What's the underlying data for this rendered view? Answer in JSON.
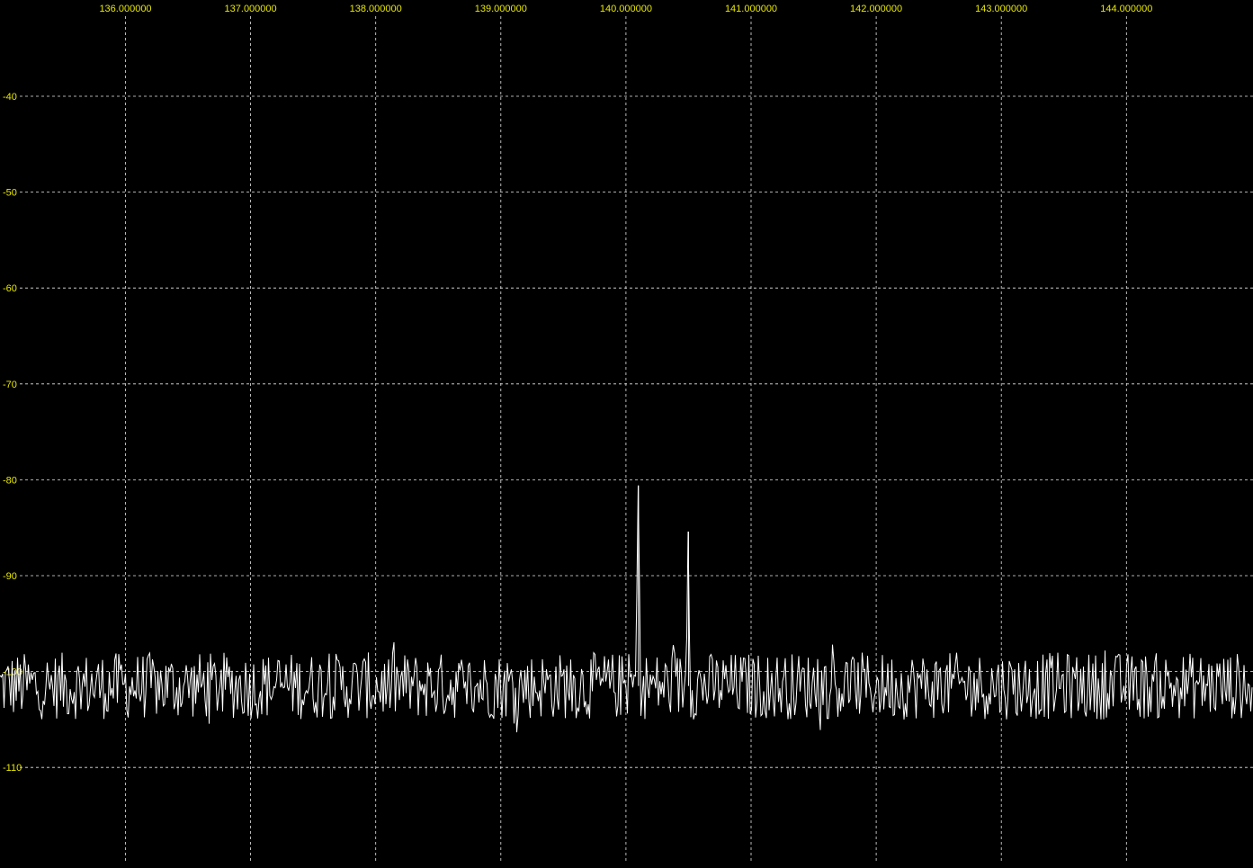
{
  "colors": {
    "background": "#000000",
    "grid": "#e6e6e6",
    "tick_label": "#e8e800",
    "trace": "#ffffff"
  },
  "chart_data": {
    "type": "line",
    "title": "",
    "xlabel": "",
    "ylabel": "",
    "grid": true,
    "grid_style": "dashed",
    "x_ticks": [
      136,
      137,
      138,
      139,
      140,
      141,
      142,
      143,
      144
    ],
    "x_tick_labels": [
      "136.000000",
      "137.000000",
      "138.000000",
      "139.000000",
      "140.000000",
      "141.000000",
      "142.000000",
      "143.000000",
      "144.000000"
    ],
    "y_ticks": [
      -40,
      -50,
      -60,
      -70,
      -80,
      -90,
      -100,
      -110
    ],
    "y_tick_labels": [
      "-40",
      "-50",
      "-60",
      "-70",
      "-80",
      "-90",
      "-100",
      "-110"
    ],
    "xlim": [
      135.0,
      145.0
    ],
    "ylim": [
      -30.0,
      -120.0
    ],
    "series": [
      {
        "noise_floor_db": -101.5,
        "noise_min_db": -106,
        "noise_max_db": -98,
        "peaks": [
          {
            "x": 140.1,
            "y": -80.6
          },
          {
            "x": 140.5,
            "y": -85.4
          }
        ]
      }
    ]
  }
}
